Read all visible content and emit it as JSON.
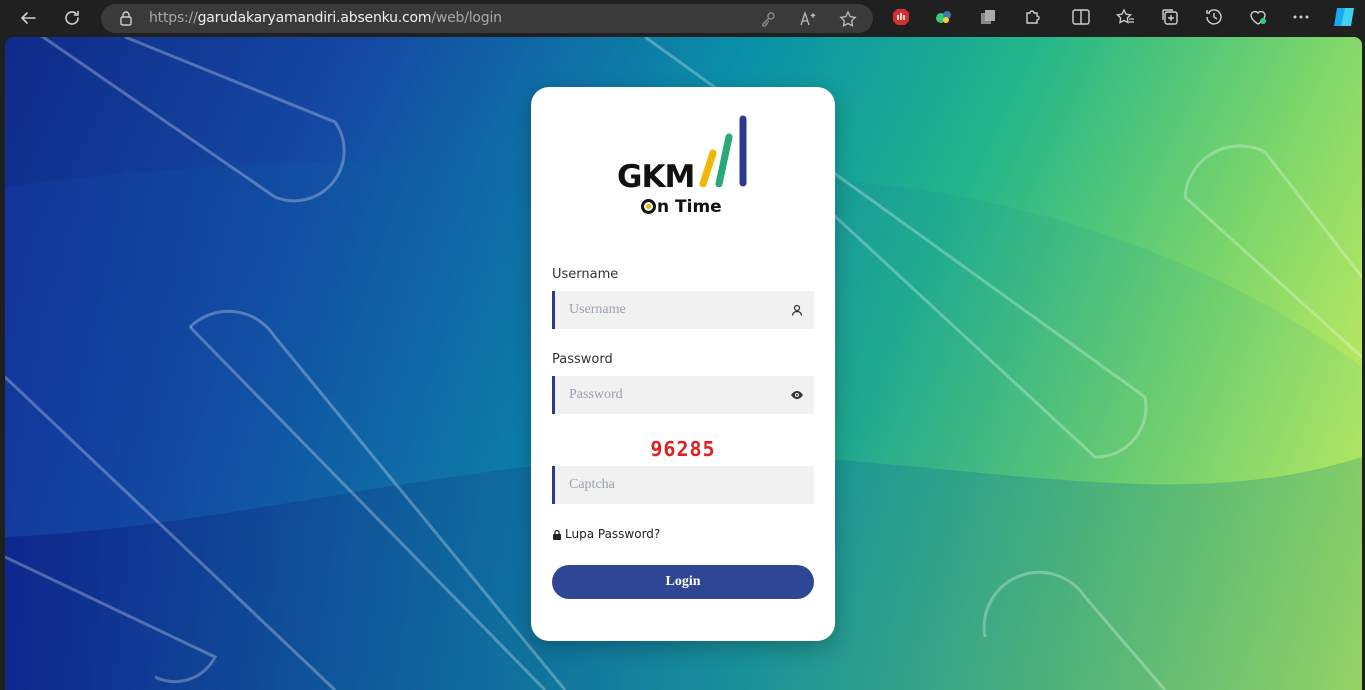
{
  "browser": {
    "url_prefix": "https://",
    "url_host": "garudakaryamandiri.absenku.com",
    "url_path": "/web/login"
  },
  "logo": {
    "word": "GKM",
    "tagline": "n Time",
    "bar_colors": [
      "#f2b705",
      "#2aa876",
      "#2c3a8f"
    ]
  },
  "form": {
    "username_label": "Username",
    "username_placeholder": "Username",
    "password_label": "Password",
    "password_placeholder": "Password",
    "captcha_code": "96285",
    "captcha_placeholder": "Captcha",
    "forgot_label": "Lupa Password?",
    "login_label": "Login"
  },
  "colors": {
    "accent": "#2f4694",
    "captcha": "#e02020"
  }
}
